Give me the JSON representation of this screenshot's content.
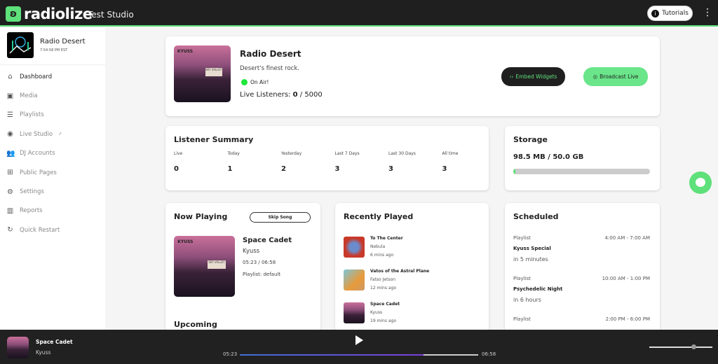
{
  "header": {
    "brand": "radiolize",
    "studio": "Test Studio",
    "tutorials_label": "Tutorials",
    "accent": "#5ee07a"
  },
  "station": {
    "name": "Radio Desert",
    "time": "7:54:58 PM EST"
  },
  "sidebar": {
    "items": [
      {
        "label": "Dashboard",
        "icon": "home-icon",
        "active": true
      },
      {
        "label": "Media",
        "icon": "media-icon"
      },
      {
        "label": "Playlists",
        "icon": "list-icon"
      },
      {
        "label": "Live Studio",
        "icon": "disc-icon"
      },
      {
        "label": "DJ Accounts",
        "icon": "people-icon"
      },
      {
        "label": "Public Pages",
        "icon": "page-icon"
      },
      {
        "label": "Settings",
        "icon": "gear-icon"
      },
      {
        "label": "Reports",
        "icon": "chart-icon"
      },
      {
        "label": "Quick Restart",
        "icon": "restart-icon"
      }
    ]
  },
  "overview": {
    "name": "Radio Desert",
    "tagline": "Desert's finest rock.",
    "status": "On Air!",
    "listeners_label": "Live Listeners:",
    "listeners_current": "0",
    "listeners_max": "/ 5000",
    "embed_label": "Embed Widgets",
    "broadcast_label": "Broadcast Live",
    "album_band": "KYUSS",
    "album_sign": "SKY VALLEY"
  },
  "listener_summary": {
    "title": "Listener Summary",
    "stats": [
      {
        "label": "Live",
        "value": "0"
      },
      {
        "label": "Today",
        "value": "1"
      },
      {
        "label": "Yesterday",
        "value": "2"
      },
      {
        "label": "Last 7 Days",
        "value": "3"
      },
      {
        "label": "Last 30 Days",
        "value": "3"
      },
      {
        "label": "All time",
        "value": "3"
      }
    ]
  },
  "storage": {
    "title": "Storage",
    "usage": "98.5 MB / 50.0 GB",
    "fraction": 0.002
  },
  "now_playing": {
    "title": "Now Playing",
    "skip_label": "Skip Song",
    "song": "Space Cadet",
    "artist": "Kyuss",
    "progress": "05:23 / 06:58",
    "playlist": "Playlist: default",
    "upcoming": "Upcoming"
  },
  "recently_played": {
    "title": "Recently Played",
    "items": [
      {
        "title": "To The Center",
        "artist": "Nebula",
        "ago": "6 mins ago"
      },
      {
        "title": "Vatos of the Astral Plane",
        "artist": "Fatso Jetson",
        "ago": "12 mins ago"
      },
      {
        "title": "Space Cadet",
        "artist": "Kyuss",
        "ago": "19 mins ago"
      }
    ]
  },
  "scheduled": {
    "title": "Scheduled",
    "items": [
      {
        "kind": "Playlist",
        "time": "4:00 AM - 7:00 AM",
        "name": "Kyuss Special",
        "relative": "in 5 minutes"
      },
      {
        "kind": "Playlist",
        "time": "10:00 AM - 1:00 PM",
        "name": "Psychedelic Night",
        "relative": "in 6 hours"
      },
      {
        "kind": "Playlist",
        "time": "2:00 PM - 6:00 PM"
      }
    ]
  },
  "player": {
    "song": "Space Cadet",
    "artist": "Kyuss",
    "elapsed": "05:23",
    "duration": "06:58",
    "progress": 0.77,
    "volume": 0.7
  }
}
